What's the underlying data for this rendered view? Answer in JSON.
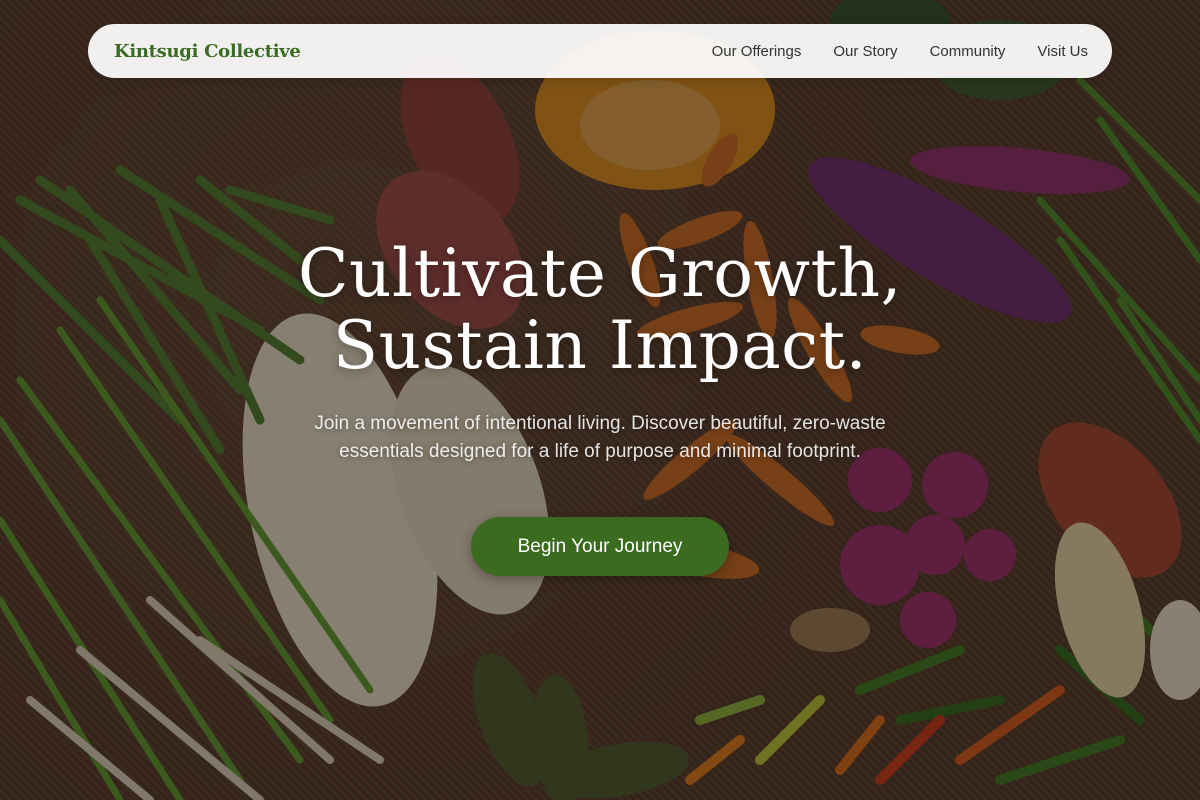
{
  "nav": {
    "brand": "Kintsugi Collective",
    "links": [
      "Our Offerings",
      "Our Story",
      "Community",
      "Visit Us"
    ]
  },
  "hero": {
    "headline_line1": "Cultivate Growth,",
    "headline_line2": "Sustain Impact.",
    "subtitle_line1": "Join a movement of intentional living. Discover beautiful, zero-waste",
    "subtitle_line2": "essentials designed for a life of purpose and minimal footprint.",
    "cta_label": "Begin Your Journey"
  },
  "colors": {
    "brand": "#3b6b22",
    "cta": "#3a6b1f",
    "nav_bg": "#ffffff"
  }
}
